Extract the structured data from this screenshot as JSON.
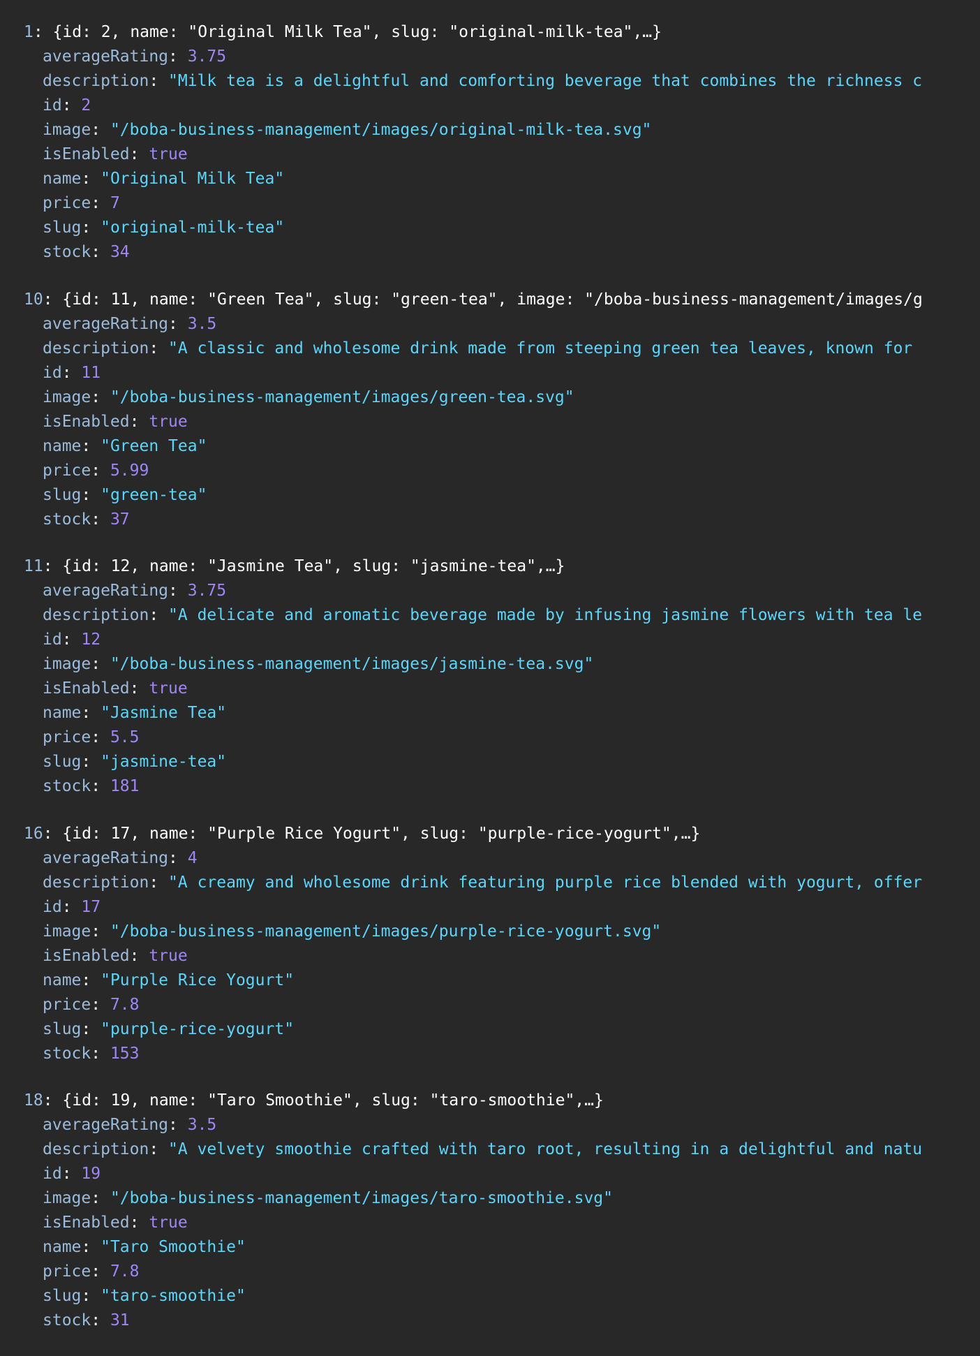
{
  "entries": [
    {
      "index": "1",
      "summary": "{id: 2, name: \"Original Milk Tea\", slug: \"original-milk-tea\",…}",
      "props": [
        {
          "key": "averageRating",
          "value": "3.75",
          "kind": "num"
        },
        {
          "key": "description",
          "value": "\"Milk tea is a delightful and comforting beverage that combines the richness c",
          "kind": "str"
        },
        {
          "key": "id",
          "value": "2",
          "kind": "num"
        },
        {
          "key": "image",
          "value": "\"/boba-business-management/images/original-milk-tea.svg\"",
          "kind": "str"
        },
        {
          "key": "isEnabled",
          "value": "true",
          "kind": "bool"
        },
        {
          "key": "name",
          "value": "\"Original Milk Tea\"",
          "kind": "str"
        },
        {
          "key": "price",
          "value": "7",
          "kind": "num"
        },
        {
          "key": "slug",
          "value": "\"original-milk-tea\"",
          "kind": "str"
        },
        {
          "key": "stock",
          "value": "34",
          "kind": "num"
        }
      ]
    },
    {
      "index": "10",
      "summary": "{id: 11, name: \"Green Tea\", slug: \"green-tea\", image: \"/boba-business-management/images/g",
      "props": [
        {
          "key": "averageRating",
          "value": "3.5",
          "kind": "num"
        },
        {
          "key": "description",
          "value": "\"A classic and wholesome drink made from steeping green tea leaves, known for",
          "kind": "str"
        },
        {
          "key": "id",
          "value": "11",
          "kind": "num"
        },
        {
          "key": "image",
          "value": "\"/boba-business-management/images/green-tea.svg\"",
          "kind": "str"
        },
        {
          "key": "isEnabled",
          "value": "true",
          "kind": "bool"
        },
        {
          "key": "name",
          "value": "\"Green Tea\"",
          "kind": "str"
        },
        {
          "key": "price",
          "value": "5.99",
          "kind": "num"
        },
        {
          "key": "slug",
          "value": "\"green-tea\"",
          "kind": "str"
        },
        {
          "key": "stock",
          "value": "37",
          "kind": "num"
        }
      ]
    },
    {
      "index": "11",
      "summary": "{id: 12, name: \"Jasmine Tea\", slug: \"jasmine-tea\",…}",
      "props": [
        {
          "key": "averageRating",
          "value": "3.75",
          "kind": "num"
        },
        {
          "key": "description",
          "value": "\"A delicate and aromatic beverage made by infusing jasmine flowers with tea le",
          "kind": "str"
        },
        {
          "key": "id",
          "value": "12",
          "kind": "num"
        },
        {
          "key": "image",
          "value": "\"/boba-business-management/images/jasmine-tea.svg\"",
          "kind": "str"
        },
        {
          "key": "isEnabled",
          "value": "true",
          "kind": "bool"
        },
        {
          "key": "name",
          "value": "\"Jasmine Tea\"",
          "kind": "str"
        },
        {
          "key": "price",
          "value": "5.5",
          "kind": "num"
        },
        {
          "key": "slug",
          "value": "\"jasmine-tea\"",
          "kind": "str"
        },
        {
          "key": "stock",
          "value": "181",
          "kind": "num"
        }
      ]
    },
    {
      "index": "16",
      "summary": "{id: 17, name: \"Purple Rice Yogurt\", slug: \"purple-rice-yogurt\",…}",
      "props": [
        {
          "key": "averageRating",
          "value": "4",
          "kind": "num"
        },
        {
          "key": "description",
          "value": "\"A creamy and wholesome drink featuring purple rice blended with yogurt, offer",
          "kind": "str"
        },
        {
          "key": "id",
          "value": "17",
          "kind": "num"
        },
        {
          "key": "image",
          "value": "\"/boba-business-management/images/purple-rice-yogurt.svg\"",
          "kind": "str"
        },
        {
          "key": "isEnabled",
          "value": "true",
          "kind": "bool"
        },
        {
          "key": "name",
          "value": "\"Purple Rice Yogurt\"",
          "kind": "str"
        },
        {
          "key": "price",
          "value": "7.8",
          "kind": "num"
        },
        {
          "key": "slug",
          "value": "\"purple-rice-yogurt\"",
          "kind": "str"
        },
        {
          "key": "stock",
          "value": "153",
          "kind": "num"
        }
      ]
    },
    {
      "index": "18",
      "summary": "{id: 19, name: \"Taro Smoothie\", slug: \"taro-smoothie\",…}",
      "props": [
        {
          "key": "averageRating",
          "value": "3.5",
          "kind": "num"
        },
        {
          "key": "description",
          "value": "\"A velvety smoothie crafted with taro root, resulting in a delightful and natu",
          "kind": "str"
        },
        {
          "key": "id",
          "value": "19",
          "kind": "num"
        },
        {
          "key": "image",
          "value": "\"/boba-business-management/images/taro-smoothie.svg\"",
          "kind": "str"
        },
        {
          "key": "isEnabled",
          "value": "true",
          "kind": "bool"
        },
        {
          "key": "name",
          "value": "\"Taro Smoothie\"",
          "kind": "str"
        },
        {
          "key": "price",
          "value": "7.8",
          "kind": "num"
        },
        {
          "key": "slug",
          "value": "\"taro-smoothie\"",
          "kind": "str"
        },
        {
          "key": "stock",
          "value": "31",
          "kind": "num"
        }
      ]
    }
  ]
}
